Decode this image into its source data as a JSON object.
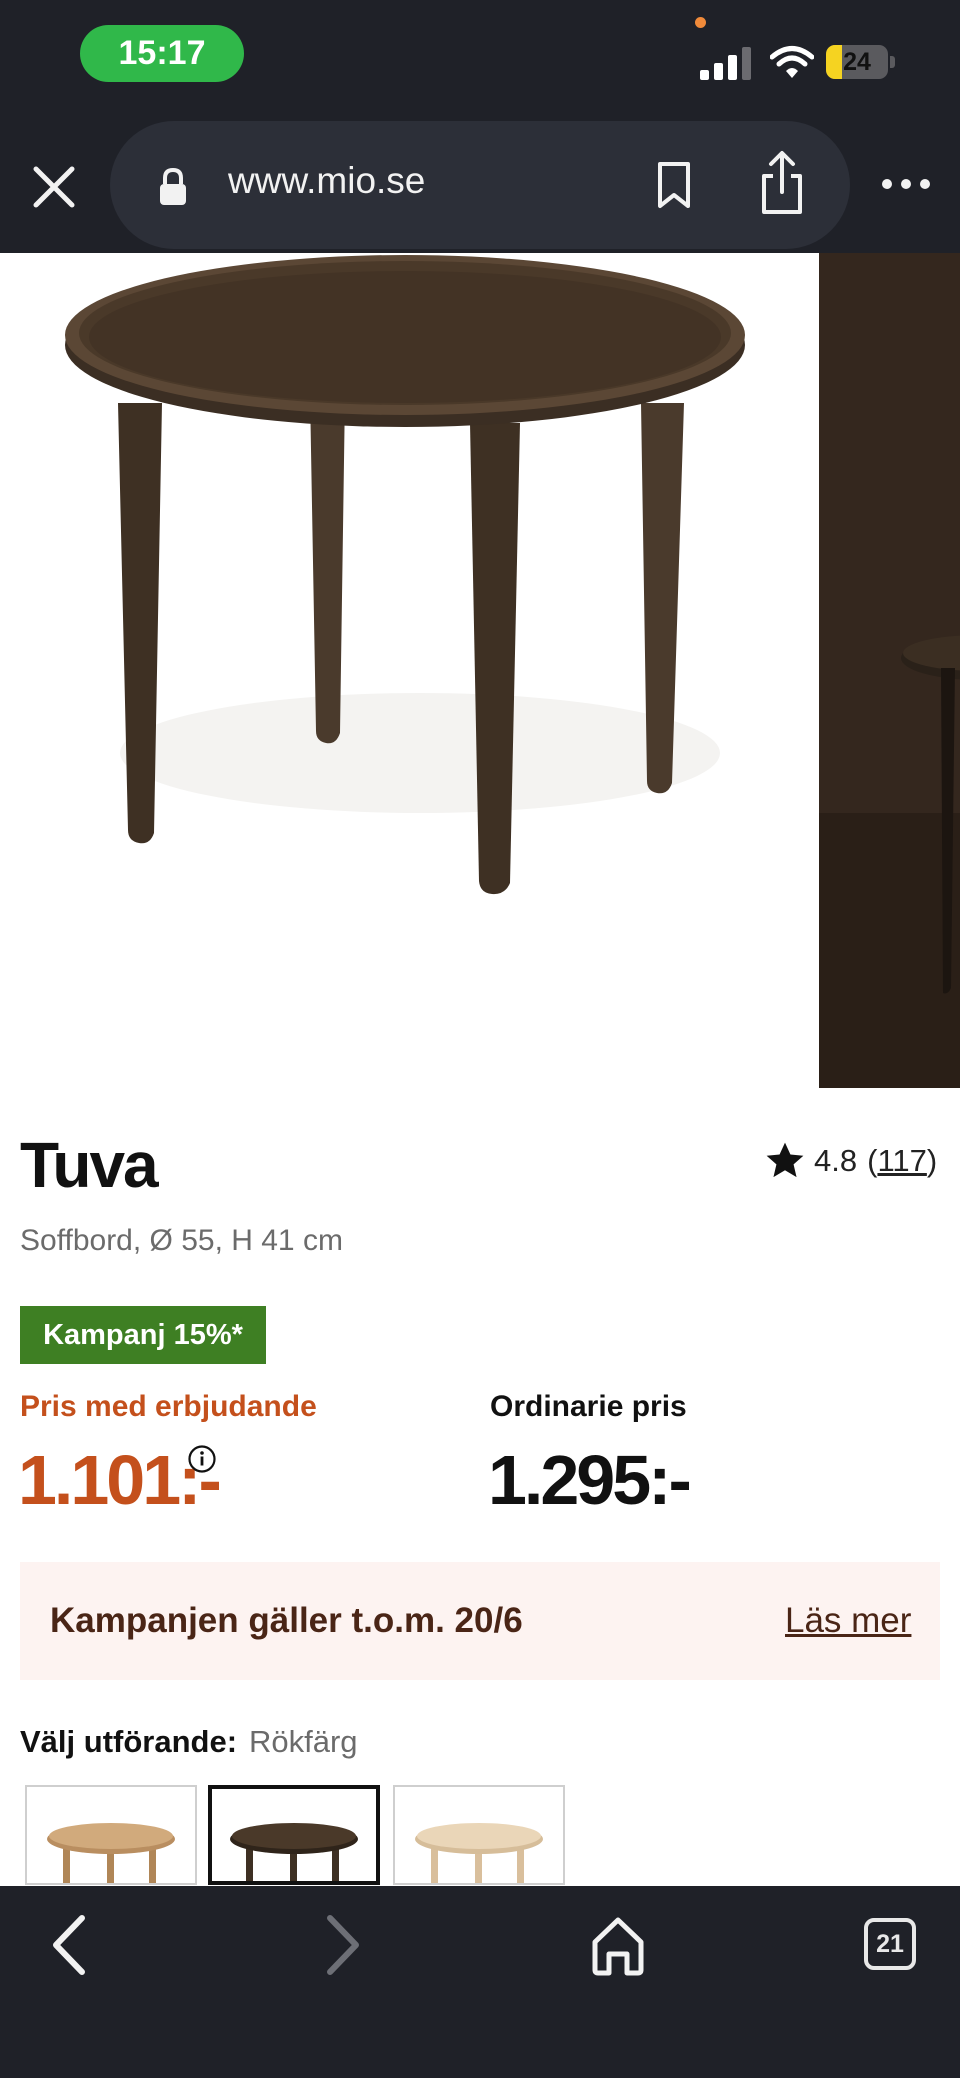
{
  "status_bar": {
    "time": "15:17",
    "battery": "24",
    "icons": [
      "cellular-signal-icon",
      "wifi-icon",
      "battery-icon"
    ],
    "colors": {
      "time_pill": "#30b84a",
      "battery_fill": "#f5d321"
    }
  },
  "browser": {
    "url": "www.mio.se",
    "icons": [
      "close-icon",
      "lock-icon",
      "bookmark-icon",
      "share-icon",
      "more-icon"
    ],
    "tab_count": "21"
  },
  "product": {
    "name": "Tuva",
    "rating_value": "4.8",
    "rating_open": "(",
    "rating_count": "117",
    "rating_close": ")",
    "subtitle": "Soffbord, Ø 55, H 41 cm",
    "campaign_badge": "Kampanj 15%*",
    "offer_label": "Pris med erbjudande",
    "offer_price": "1.101:-",
    "ordinary_label": "Ordinarie pris",
    "ordinary_price": "1.295:-",
    "campaign_note": "Kampanjen gäller t.o.m. 20/6",
    "read_more": "Läs mer",
    "variant_label": "Välj utförande:",
    "variant_value": "Rökfärg",
    "colors": {
      "offer": "#c4501c",
      "badge": "#3e7f23",
      "campaign_box": "#fdf3f1"
    }
  },
  "toolbar": {
    "icons": [
      "back-icon",
      "forward-icon",
      "home-icon",
      "tabs-icon"
    ]
  }
}
